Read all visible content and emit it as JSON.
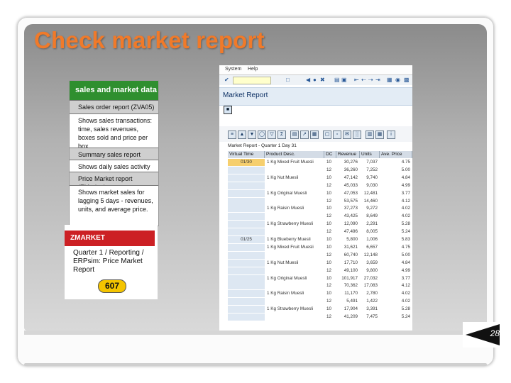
{
  "slide": {
    "title": "Check market report",
    "page_number": "28"
  },
  "info_panel": {
    "header": "sales and market data",
    "rows": [
      {
        "text": "Sales order report (ZVA05)",
        "style": "grey"
      },
      {
        "text": "Shows sales transactions: time, sales revenues, boxes sold and price per box.",
        "style": "white"
      },
      {
        "text": "Summary sales report (ZVC2)",
        "style": "grey"
      },
      {
        "text": "Shows daily sales activity",
        "style": "white"
      },
      {
        "text": "Price Market report (ZMarket)",
        "style": "grey"
      },
      {
        "text": "Shows market sales for lagging 5 days - revenues, units, and average price.",
        "style": "white"
      }
    ]
  },
  "zmarket_card": {
    "header": "ZMARKET",
    "text": "Quarter 1 / Reporting / ERPsim: Price Market Report",
    "code": "607"
  },
  "sap": {
    "menu": [
      "System",
      "Help"
    ],
    "window_title": "Market Report",
    "report_header": "Market Report - Quarter 1 Day 31",
    "columns": [
      "Virtual Time",
      "Product Desc.",
      "DC",
      "Revenue",
      "Units",
      "Ave. Price"
    ],
    "rows": [
      {
        "time": "01/30",
        "product": "1 Kg Mixed Fruit Muesli",
        "dc": "10",
        "revenue": "30,276",
        "units": "7,037",
        "price": "4.75"
      },
      {
        "time": "",
        "product": "",
        "dc": "12",
        "revenue": "36,260",
        "units": "7,252",
        "price": "5.00"
      },
      {
        "time": "",
        "product": "1 Kg Nut Muesli",
        "dc": "10",
        "revenue": "47,142",
        "units": "9,740",
        "price": "4.84"
      },
      {
        "time": "",
        "product": "",
        "dc": "12",
        "revenue": "45,033",
        "units": "9,030",
        "price": "4.99"
      },
      {
        "time": "",
        "product": "1 Kg Original Muesli",
        "dc": "10",
        "revenue": "47,053",
        "units": "12,481",
        "price": "3.77"
      },
      {
        "time": "",
        "product": "",
        "dc": "12",
        "revenue": "53,575",
        "units": "14,460",
        "price": "4.12"
      },
      {
        "time": "",
        "product": "1 Kg Raisin Muesli",
        "dc": "10",
        "revenue": "37,273",
        "units": "9,272",
        "price": "4.02"
      },
      {
        "time": "",
        "product": "",
        "dc": "12",
        "revenue": "43,425",
        "units": "8,649",
        "price": "4.02"
      },
      {
        "time": "",
        "product": "1 Kg Strawberry Muesli",
        "dc": "10",
        "revenue": "12,090",
        "units": "2,291",
        "price": "5.28"
      },
      {
        "time": "",
        "product": "",
        "dc": "12",
        "revenue": "47,496",
        "units": "8,005",
        "price": "5.24"
      },
      {
        "time": "01/25",
        "product": "1 Kg Blueberry Muesli",
        "dc": "10",
        "revenue": "5,800",
        "units": "1,006",
        "price": "5.83"
      },
      {
        "time": "",
        "product": "1 Kg Mixed Fruit Muesli",
        "dc": "10",
        "revenue": "31,621",
        "units": "6,657",
        "price": "4.75"
      },
      {
        "time": "",
        "product": "",
        "dc": "12",
        "revenue": "60,740",
        "units": "12,148",
        "price": "5.00"
      },
      {
        "time": "",
        "product": "1 Kg Nut Muesli",
        "dc": "10",
        "revenue": "17,710",
        "units": "3,659",
        "price": "4.84"
      },
      {
        "time": "",
        "product": "",
        "dc": "12",
        "revenue": "49,100",
        "units": "9,800",
        "price": "4.99"
      },
      {
        "time": "",
        "product": "1 Kg Original Muesli",
        "dc": "10",
        "revenue": "101,917",
        "units": "27,032",
        "price": "3.77"
      },
      {
        "time": "",
        "product": "",
        "dc": "12",
        "revenue": "70,362",
        "units": "17,083",
        "price": "4.12"
      },
      {
        "time": "",
        "product": "1 Kg Raisin Muesli",
        "dc": "10",
        "revenue": "11,170",
        "units": "2,780",
        "price": "4.02"
      },
      {
        "time": "",
        "product": "",
        "dc": "12",
        "revenue": "5,491",
        "units": "1,422",
        "price": "4.02"
      },
      {
        "time": "",
        "product": "1 Kg Strawberry Muesli",
        "dc": "10",
        "revenue": "17,904",
        "units": "3,391",
        "price": "5.28"
      },
      {
        "time": "",
        "product": "",
        "dc": "12",
        "revenue": "41,209",
        "units": "7,475",
        "price": "5.24"
      }
    ]
  },
  "colors": {
    "title": "#f07a2a",
    "info_header": "#2f8f2f",
    "zmarket_header": "#cc2024",
    "code_badge": "#f4c400",
    "highlight_cell": "#f6cf6e",
    "column_tint": "#dde7f2"
  }
}
